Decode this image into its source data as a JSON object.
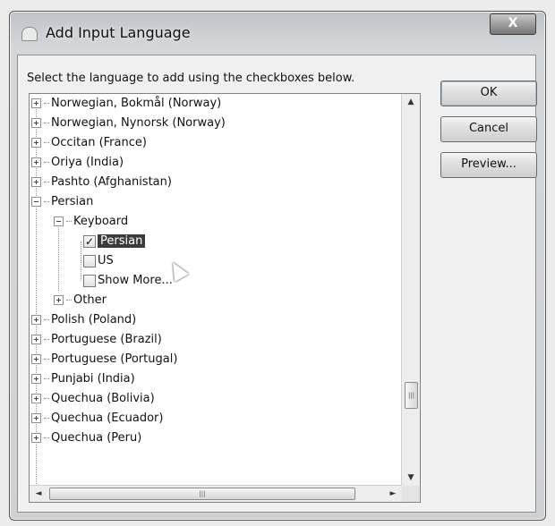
{
  "dialog": {
    "title": "Add Input Language",
    "close_label": "X",
    "instruction": "Select the language to add using the checkboxes below."
  },
  "buttons": {
    "ok": "OK",
    "cancel": "Cancel",
    "preview": "Preview..."
  },
  "tree": {
    "items": [
      {
        "label": "Norwegian, Bokmål (Norway)",
        "expander": "plus"
      },
      {
        "label": "Norwegian, Nynorsk (Norway)",
        "expander": "plus"
      },
      {
        "label": "Occitan (France)",
        "expander": "plus"
      },
      {
        "label": "Oriya (India)",
        "expander": "plus"
      },
      {
        "label": "Pashto (Afghanistan)",
        "expander": "plus"
      },
      {
        "label": "Persian",
        "expander": "minus"
      },
      {
        "label": "Keyboard",
        "expander": "minus"
      },
      {
        "label": "Persian",
        "checked": true,
        "selected": true
      },
      {
        "label": "US",
        "checked": false
      },
      {
        "label": "Show More...",
        "checked": false
      },
      {
        "label": "Other",
        "expander": "plus"
      },
      {
        "label": "Polish (Poland)",
        "expander": "plus"
      },
      {
        "label": "Portuguese (Brazil)",
        "expander": "plus"
      },
      {
        "label": "Portuguese (Portugal)",
        "expander": "plus"
      },
      {
        "label": "Punjabi (India)",
        "expander": "plus"
      },
      {
        "label": "Quechua (Bolivia)",
        "expander": "plus"
      },
      {
        "label": "Quechua (Ecuador)",
        "expander": "plus"
      },
      {
        "label": "Quechua (Peru)",
        "expander": "plus"
      }
    ]
  },
  "icons": {
    "app": "keyboard-icon",
    "check": "✓",
    "scroll_up": "▲",
    "scroll_down": "▼",
    "scroll_left": "◄",
    "scroll_right": "►",
    "grip": "|||"
  }
}
